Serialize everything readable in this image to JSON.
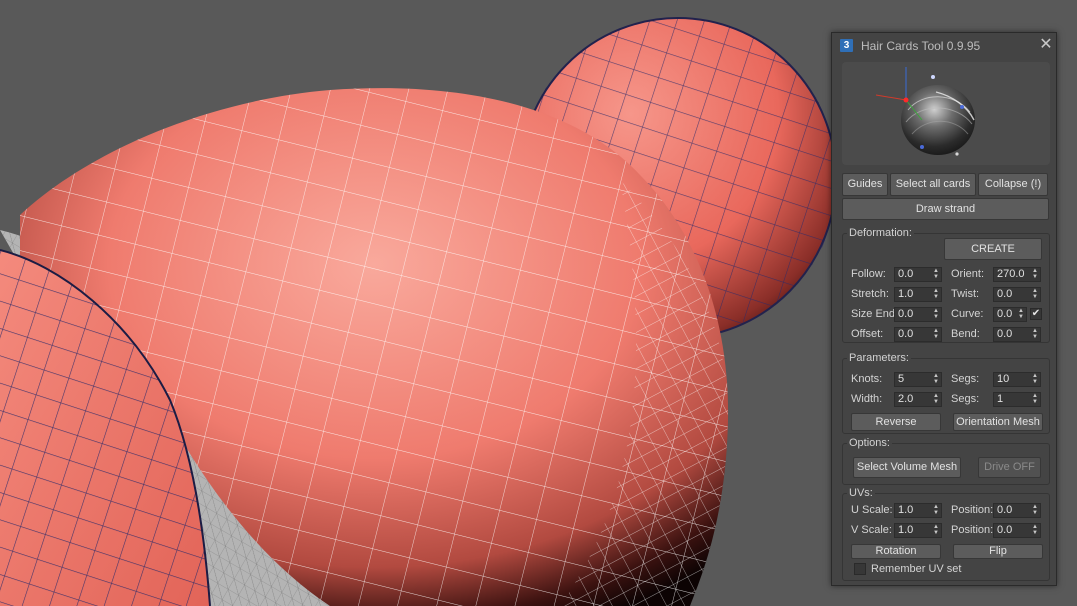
{
  "window": {
    "title": "Hair Cards Tool 0.9.95",
    "icon": "3",
    "close_glyph": "✕"
  },
  "toolbar": {
    "guides_label": "Guides",
    "select_all_label": "Select all cards",
    "collapse_label": "Collapse (!)",
    "draw_strand_label": "Draw strand"
  },
  "deformation": {
    "title": "Deformation:",
    "create_label": "CREATE",
    "follow_label": "Follow:",
    "follow_value": "0.0",
    "orient_label": "Orient:",
    "orient_value": "270.0",
    "stretch_label": "Stretch:",
    "stretch_value": "1.0",
    "twist_label": "Twist:",
    "twist_value": "0.0",
    "size_end_label": "Size End",
    "size_end_value": "0.0",
    "curve_label": "Curve:",
    "curve_value": "0.0",
    "curve_checked_glyph": "✔",
    "offset_label": "Offset:",
    "offset_value": "0.0",
    "bend_label": "Bend:",
    "bend_value": "0.0"
  },
  "parameters": {
    "title": "Parameters:",
    "knots_label": "Knots:",
    "knots_value": "5",
    "segs_label": "Segs:",
    "segs_value": "10",
    "width_label": "Width:",
    "width_value": "2.0",
    "segs2_label": "Segs:",
    "segs2_value": "1",
    "reverse_label": "Reverse",
    "orientation_mesh_label": "Orientation Mesh"
  },
  "options": {
    "title": "Options:",
    "select_volume_mesh_label": "Select Volume Mesh",
    "drive_off_label": "Drive OFF"
  },
  "uvs": {
    "title": "UVs:",
    "u_scale_label": "U Scale:",
    "u_scale_value": "1.0",
    "u_position_label": "Position:",
    "u_position_value": "0.0",
    "v_scale_label": "V Scale:",
    "v_scale_value": "1.0",
    "v_position_label": "Position:",
    "v_position_value": "0.0",
    "rotation_label": "Rotation",
    "flip_label": "Flip",
    "remember_uv_label": "Remember UV set"
  },
  "spinner_glyphs": {
    "up": "▲",
    "down": "▼"
  },
  "colors": {
    "viewport_bg": "#5a5a5a",
    "mesh_salmon": "#f07a6e",
    "panel_bg": "#444444",
    "accent_blue": "#2f6fb7"
  }
}
